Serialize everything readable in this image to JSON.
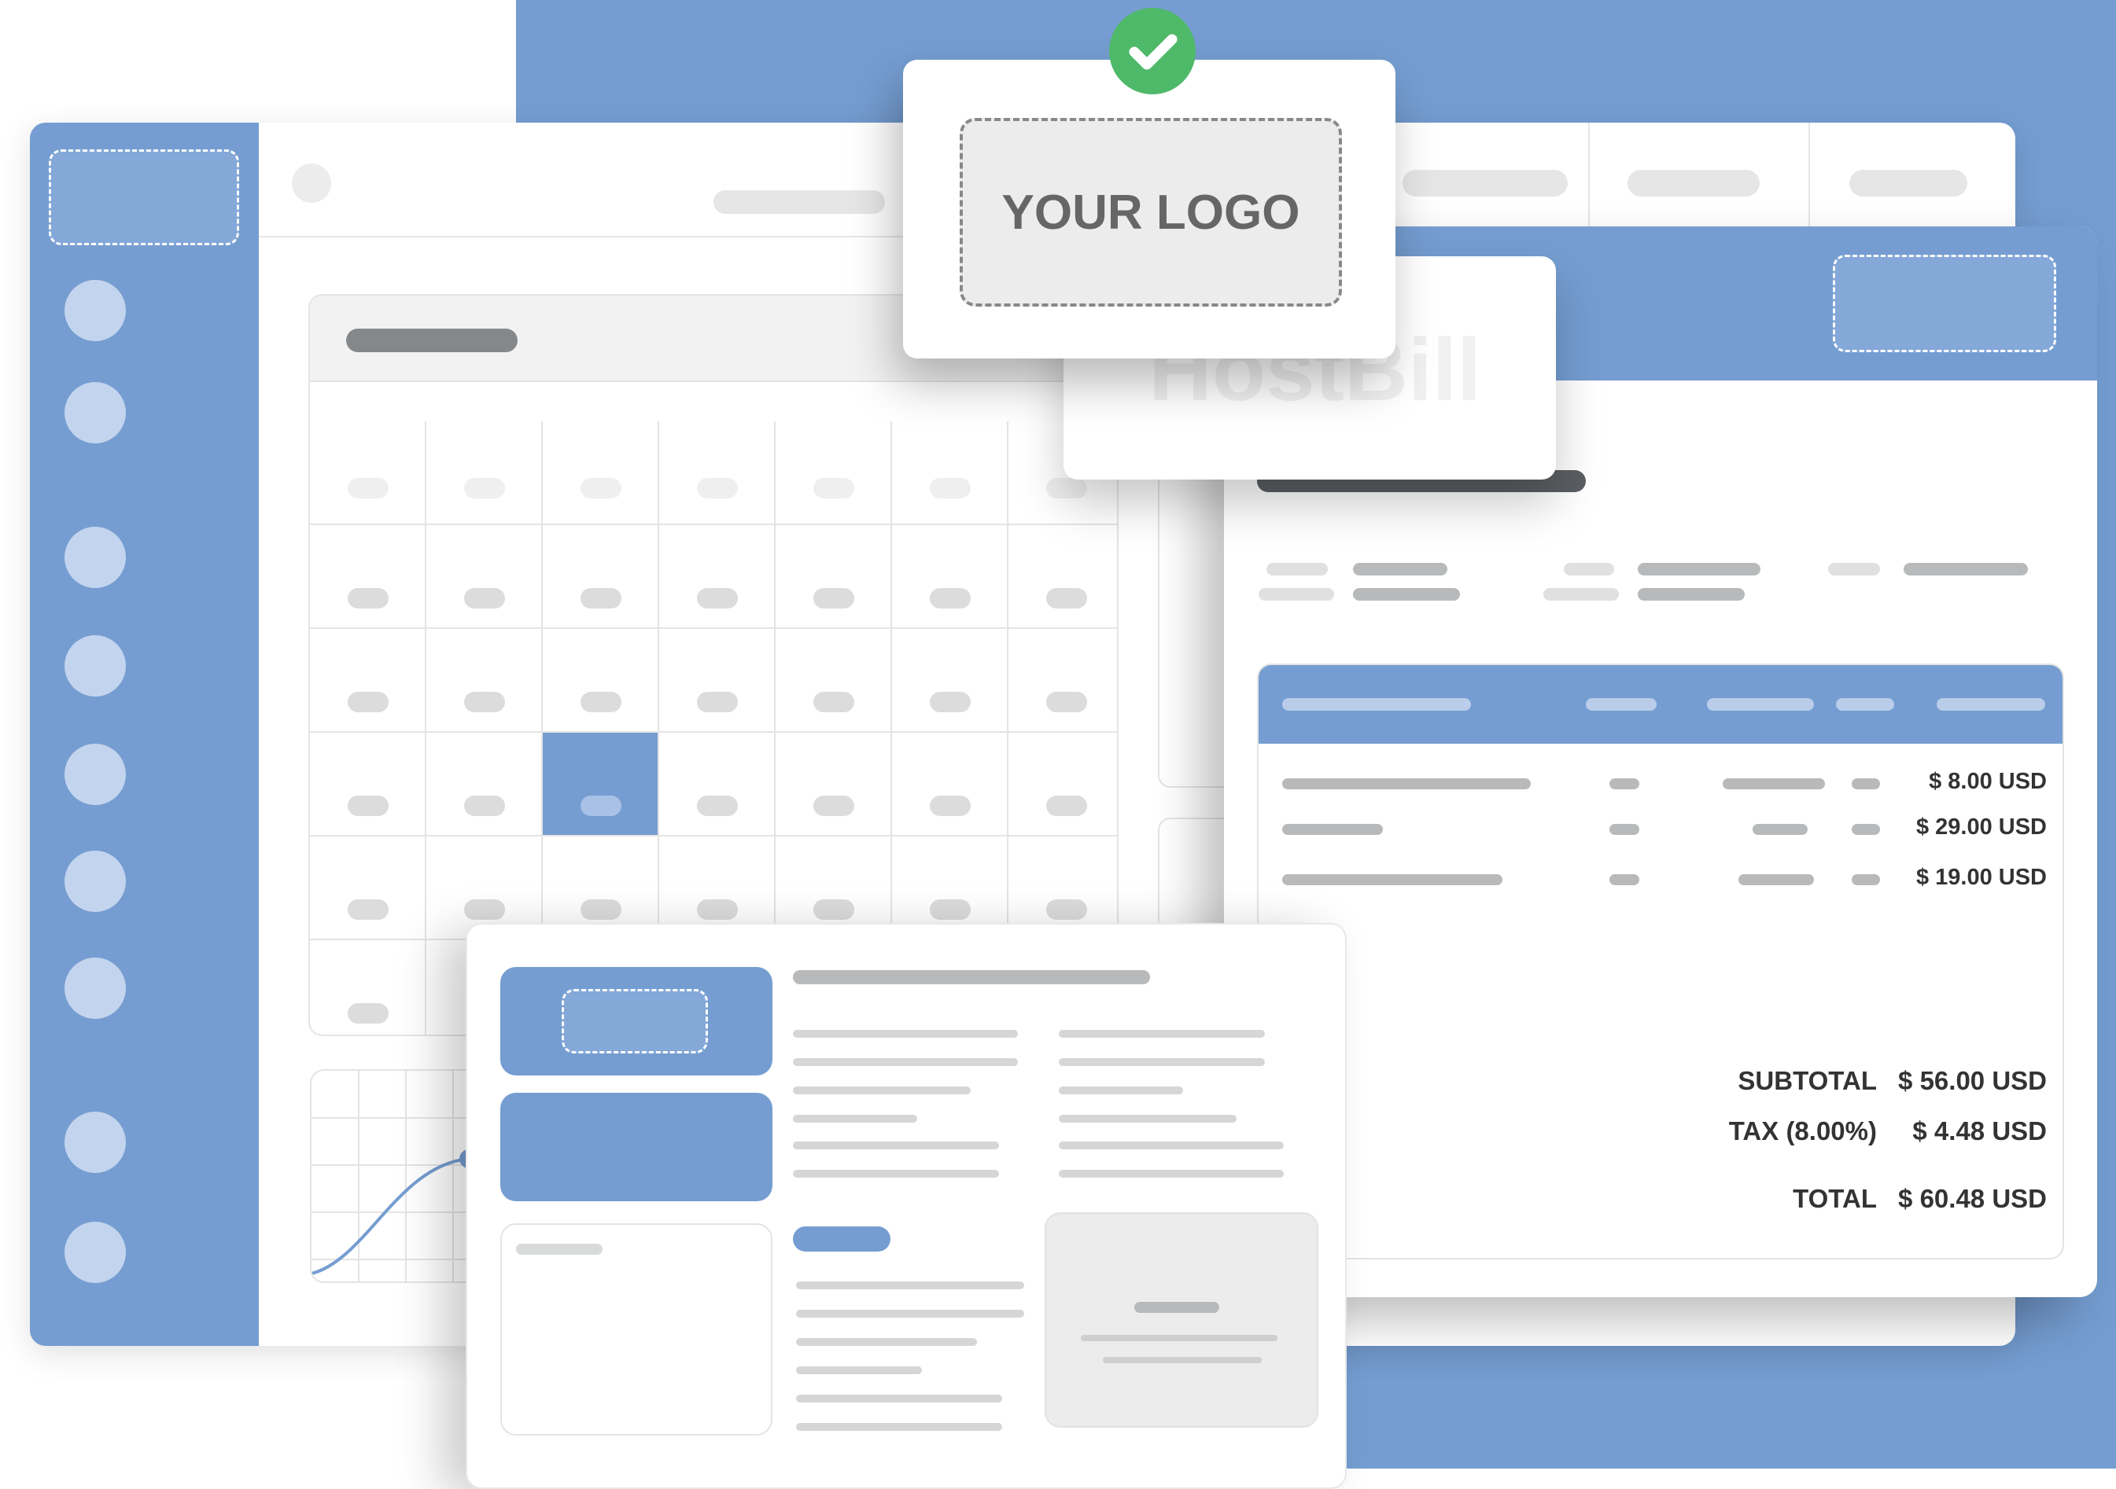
{
  "colors": {
    "accent": "#759dd1",
    "accent_light": "#c3d4ee",
    "success": "#4fb96a",
    "text_dark": "#333333"
  },
  "logo_card": {
    "logo_text": "YOUR LOGO",
    "status_icon": "check-icon"
  },
  "brand_watermark": "HostBill",
  "invoice": {
    "lines": [
      {
        "amount": "$ 8.00 USD"
      },
      {
        "amount": "$ 29.00 USD"
      },
      {
        "amount": "$ 19.00 USD"
      }
    ],
    "subtotal_label": "SUBTOTAL",
    "subtotal_value": "$ 56.00 USD",
    "tax_label": "TAX (8.00%)",
    "tax_value": "$ 4.48 USD",
    "total_label": "TOTAL",
    "total_value": "$ 60.48 USD"
  },
  "sidebar": {
    "items": [
      "menu",
      "menu",
      "menu",
      "menu",
      "menu",
      "menu",
      "menu",
      "menu",
      "menu"
    ]
  },
  "calendar": {
    "selected_row": 3,
    "selected_col": 2
  }
}
